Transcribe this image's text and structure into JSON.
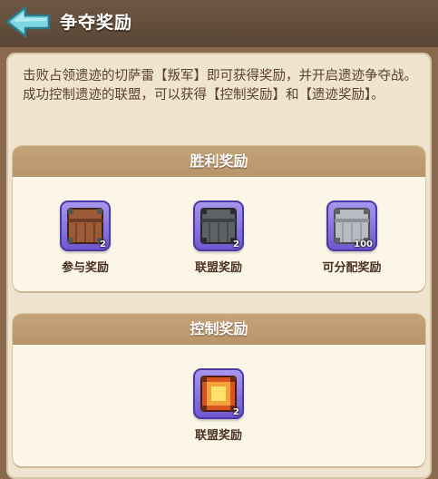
{
  "header": {
    "title": "争夺奖励",
    "back_icon": "back-arrow-icon"
  },
  "description": "击败占领遗迹的切萨雷【叛军】即可获得奖励，并开启遗迹争夺战。成功控制遗迹的联盟，可以获得【控制奖励】和【遗迹奖励】。",
  "victory_section": {
    "title": "胜利奖励",
    "items": [
      {
        "label": "参与奖励",
        "count": "2",
        "icon": "bronze-chest-icon"
      },
      {
        "label": "联盟奖励",
        "count": "2",
        "icon": "iron-chest-icon"
      },
      {
        "label": "可分配奖励",
        "count": "100",
        "icon": "silver-chest-icon"
      }
    ]
  },
  "control_section": {
    "title": "控制奖励",
    "items": [
      {
        "label": "联盟奖励",
        "count": "2",
        "icon": "fire-chest-icon"
      }
    ]
  },
  "colors": {
    "background": "#8a6a4f",
    "panel": "#efe4cf",
    "section_header": "#b8946a",
    "icon_frame": "#7b66dc",
    "back_arrow": "#7fd6e3"
  }
}
